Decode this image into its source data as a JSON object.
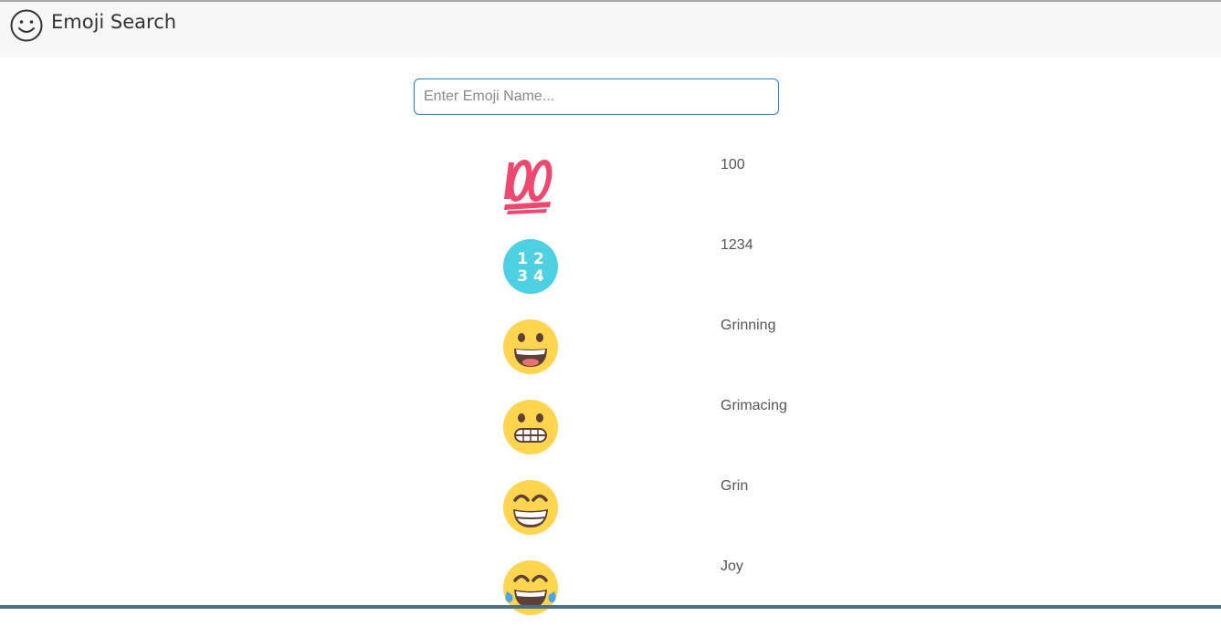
{
  "header": {
    "title": "Emoji Search",
    "logo_icon": "smiley-outline-icon"
  },
  "search": {
    "placeholder": "Enter Emoji Name...",
    "value": ""
  },
  "emojis": [
    {
      "label": "100",
      "icon": "hundred-points-icon"
    },
    {
      "label": "1234",
      "icon": "input-numbers-icon"
    },
    {
      "label": "Grinning",
      "icon": "grinning-face-icon"
    },
    {
      "label": "Grimacing",
      "icon": "grimacing-face-icon"
    },
    {
      "label": "Grin",
      "icon": "grin-face-icon"
    },
    {
      "label": "Joy",
      "icon": "joy-face-icon"
    }
  ],
  "colors": {
    "input_border": "#2f7db9",
    "header_bg": "#f7f7f7",
    "label_text": "#555555",
    "emoji_yellow": "#ffd54f",
    "hundred_red": "#ef476f",
    "numbers_teal": "#4dd0e1"
  }
}
